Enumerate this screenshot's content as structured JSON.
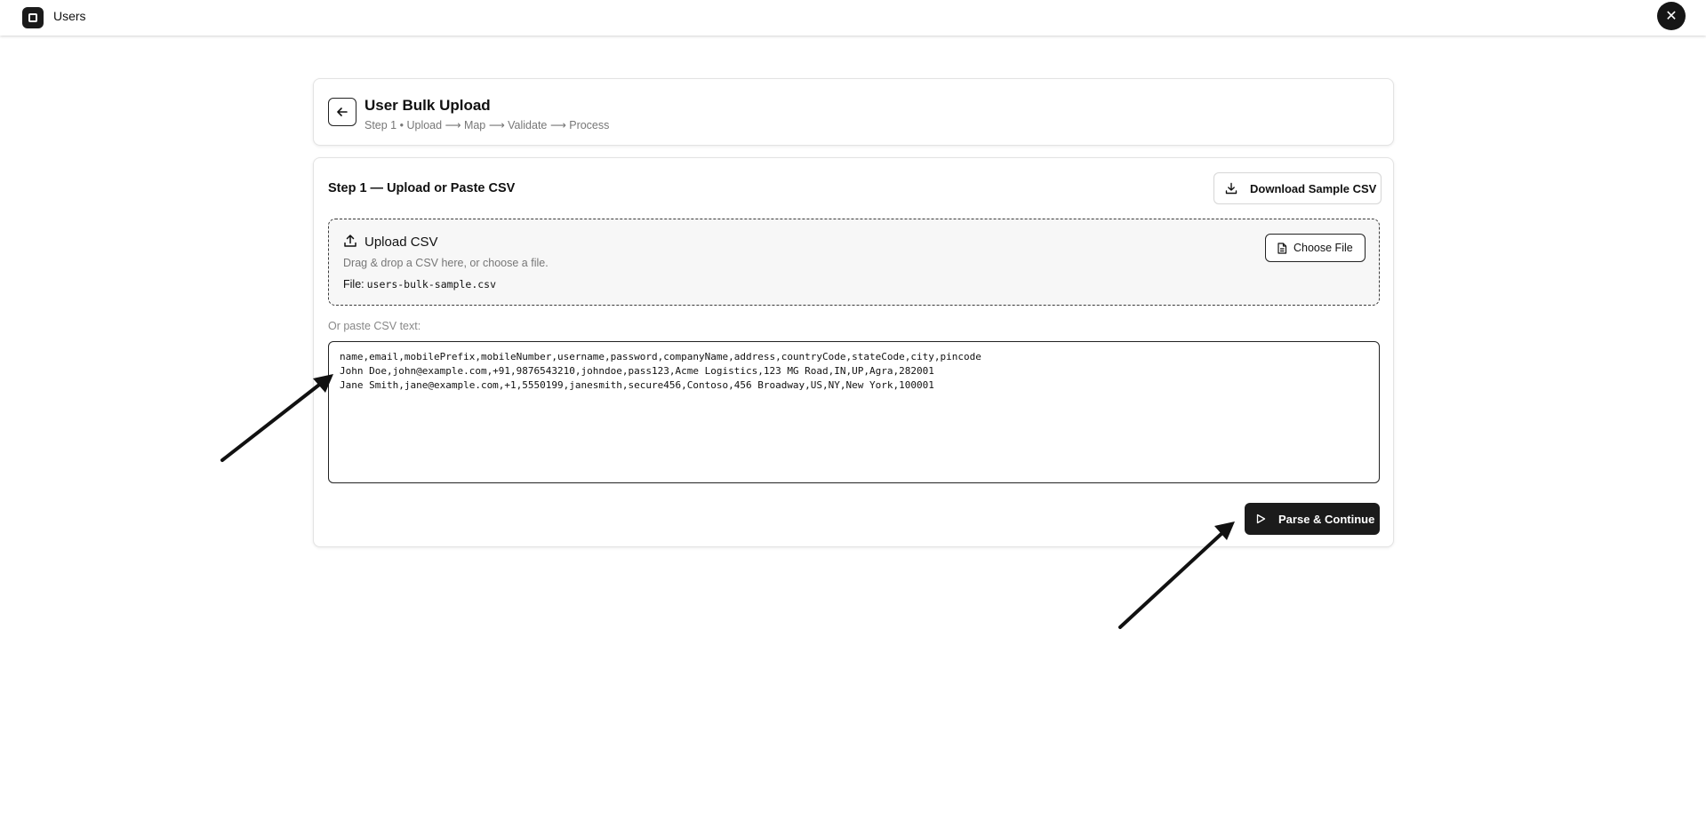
{
  "topbar": {
    "app_title": "Users",
    "app_icon": "app-square-icon",
    "close_icon": "close-icon",
    "close_glyph": "✕"
  },
  "header": {
    "title": "User Bulk Upload",
    "subtitle": "Step 1 • Upload ⟶ Map ⟶ Validate ⟶ Process",
    "back_icon": "arrow-left-icon"
  },
  "main": {
    "step_title": "Step 1 — Upload or Paste CSV",
    "download_label": "Download Sample CSV",
    "download_icon": "download-icon",
    "dropzone": {
      "title": "Upload CSV",
      "description": "Drag & drop a CSV here, or choose a file.",
      "file_label": "File:",
      "file_name": "users-bulk-sample.csv",
      "choose_label": "Choose File",
      "upload_icon": "upload-icon",
      "file_icon": "file-icon"
    },
    "paste_label": "Or paste CSV text:",
    "csv_text": "name,email,mobilePrefix,mobileNumber,username,password,companyName,address,countryCode,stateCode,city,pincode\nJohn Doe,john@example.com,+91,9876543210,johndoe,pass123,Acme Logistics,123 MG Road,IN,UP,Agra,282001\nJane Smith,jane@example.com,+1,5550199,janesmith,secure456,Contoso,456 Broadway,US,NY,New York,100001",
    "parse_label": "Parse & Continue",
    "parse_icon": "play-icon"
  },
  "colors": {
    "primary_dark": "#1b1b1b",
    "border": "#e3e3e3",
    "muted_text": "#777777",
    "dropzone_bg": "#f7f7f7"
  }
}
